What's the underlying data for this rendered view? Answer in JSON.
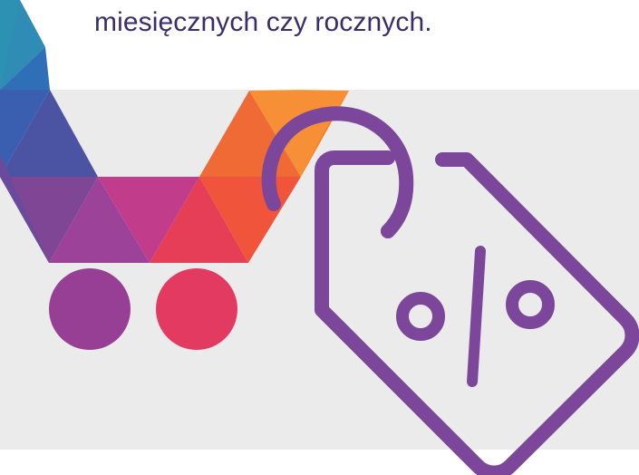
{
  "text": {
    "caption": "miesięcznych czy rocznych."
  },
  "illustration": {
    "cart_icon": "shopping-cart-icon",
    "tag_icon": "price-tag-icon",
    "percent_symbol": "%",
    "colors": {
      "background_panel": "#ebebeb",
      "text": "#3a2d68",
      "tag_stroke": "#7c479a",
      "wheel_left": "#963f95",
      "wheel_right": "#e33a62",
      "cart_blue": "#2f6fb8",
      "cart_teal": "#2d91b4",
      "cart_purple": "#7e4694",
      "cart_magenta": "#c23c8c",
      "cart_red": "#e73e57",
      "cart_orange": "#f06a35",
      "cart_yellow": "#fba62f"
    }
  }
}
